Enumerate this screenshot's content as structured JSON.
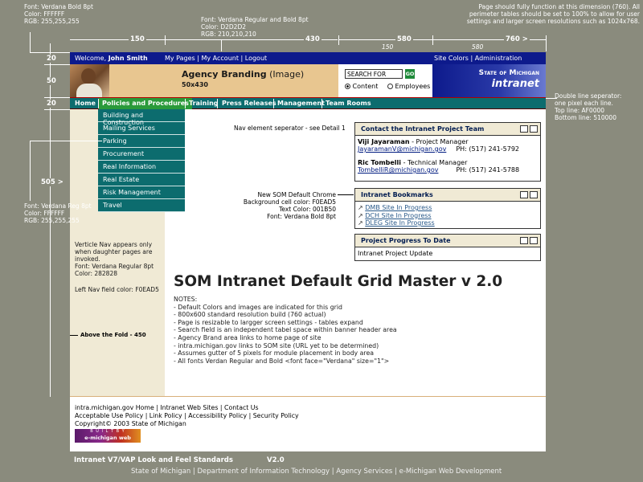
{
  "notes_top_right": "Page should fully function at this dimension (760). All perimeter tables should be set to 100% to allow for user settings and larger screen resolutions such as 1024x768.",
  "font_notes": {
    "topleft": [
      "Font:  Verdana Bold 8pt",
      "Color: FFFFFF",
      "RGB:  255,255,255"
    ],
    "topmid": [
      "Font:  Verdana Regular and Bold 8pt",
      "Color: D2D2D2",
      "RGB:  210,210,210"
    ],
    "leftmid": [
      "Font:  Verdana Reg 8pt",
      "Color: FFFFFF",
      "RGB:  255,255,255"
    ]
  },
  "dimensions": {
    "d150": "150",
    "d430": "430",
    "d580": "580",
    "d760": "760 >",
    "d150b": "150",
    "d580b": "580",
    "h20a": "20",
    "h50": "50",
    "h20b": "20",
    "v505": "505 >"
  },
  "topbar": {
    "welcome_prefix": "Welcome, ",
    "user": "John Smith",
    "links": "My Pages | My Account | Logout",
    "right": "Site Colors | Administration"
  },
  "banner": {
    "branding": "Agency Branding",
    "branding_suffix": " (Image)",
    "size": "50x430",
    "search_value": "SEARCH FOR",
    "go": "GO",
    "radio_content": "Content",
    "radio_employees": "Employees",
    "state": "State of Michigan",
    "intranet": "intranet"
  },
  "nav": [
    "Home",
    "Policies and Procedures",
    "Training",
    "Press Releases",
    "Management",
    "Team Rooms"
  ],
  "submenu": [
    "Building and Construction",
    "Mailing Services",
    "Parking",
    "Procurement",
    "Real Information",
    "Real Estate",
    "Risk Management",
    "Travel"
  ],
  "annotations": {
    "double_line": [
      "Double line seperator:",
      "one pixel each line.",
      "Top line: AF0000",
      "Bottom line: 510000"
    ],
    "nav_sep": "Nav element seperator - see Detail 1",
    "chrome": [
      "New SOM Default Chrome",
      "Background cell color: F0EAD5",
      "Text Color: 001B50",
      "Font: Verdana Bold 8pt"
    ],
    "vertical_nav": [
      "Verticle Nav appears only",
      "when daughter pages are",
      "invoked.",
      "Font: Verdana Regular 8pt",
      "Color: 282828"
    ],
    "leftnav_color": "Left Nav field color: F0EAD5",
    "fold": "Above the Fold - 450"
  },
  "modules": {
    "contact": {
      "title": "Contact the Intranet Project Team",
      "p1_name": "Viji Jayaraman",
      "p1_role": " - Project Manager",
      "p1_email": "JayaramanV@michigan.gov",
      "p1_phone": "PH: (517) 241-5792",
      "p2_name": "Ric Tombelli",
      "p2_role": " - Technical Manager",
      "p2_email": "TombelliR@michigan.gov",
      "p2_phone": "PH: (517) 241-5788"
    },
    "bookmarks": {
      "title": "Intranet Bookmarks",
      "items": [
        "DMB Site In Progress",
        "DCH Site In Progress",
        "DLEG Site In Progress"
      ]
    },
    "progress": {
      "title": "Project Progress To Date",
      "body": "Intranet Project Update"
    }
  },
  "main": {
    "title": "SOM Intranet Default Grid Master v 2.0",
    "notes_title": "NOTES:",
    "notes": [
      "- Default Colors and images are indicated for this grid",
      "- 800x600 standard resolution build (760 actual)",
      "- Page is resizable to largger screen settings - tables expand",
      "- Search field is an independent tabel space within banner header area",
      "- Agency Brand area links to home page of site",
      "- intra.michigan.gov links to SOM site (URL yet to be determined)",
      "- Assumes gutter of 5 pixels for module placement in body area",
      "- All fonts Verdan Regular and Bold <font face=\"Verdana\" size=\"1\">"
    ]
  },
  "footer": {
    "line1": "intra.michigan.gov Home  |  Intranet Web Sites  |  Contact Us",
    "line2": "Acceptable Use Policy  |  Link Policy  |  Accessibility Policy  |  Security Policy",
    "line3": "Copyright© 2003 State of Michigan",
    "logo_top": "B U I L T  B Y",
    "logo_bottom": "e-michigan web"
  },
  "bottom": {
    "title": "Intranet V7/VAP Look and Feel Standards",
    "version": "V2.0",
    "credits": "State of Michigan | Department of Information Technology  |  Agency Services  |  e-Michigan Web Development"
  },
  "colors": {
    "background": "#8a8b7d",
    "topbar": "#0d1a8c",
    "nav": "#0c6c6e",
    "chrome": "#f0ead5",
    "chrome_text": "#001b50",
    "line_top": "#af0000",
    "line_bottom": "#510000"
  }
}
